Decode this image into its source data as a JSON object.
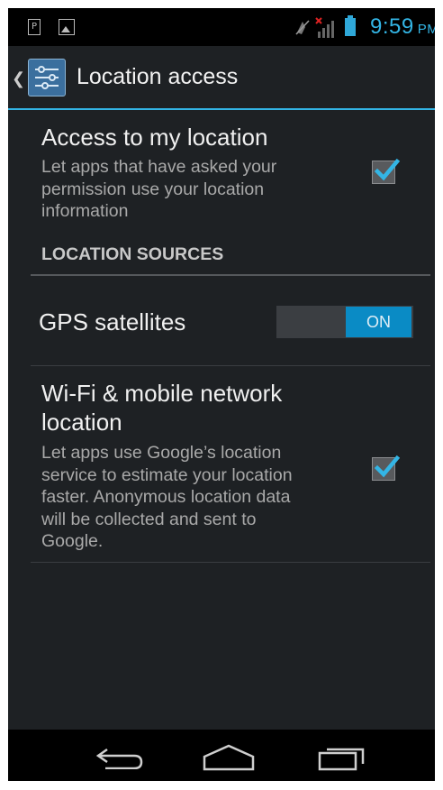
{
  "status_bar": {
    "left_icons": [
      "p-notification-icon",
      "image-notification-icon"
    ],
    "p_label": "P",
    "right_icons": [
      "mute-icon",
      "signal-icon",
      "battery-icon"
    ],
    "time": "9:59",
    "ampm": "PM",
    "accent_color": "#33b5e5"
  },
  "action_bar": {
    "back_icon": "chevron-left-icon",
    "app_icon": "settings-sliders-icon",
    "title": "Location access"
  },
  "settings": {
    "access": {
      "title": "Access to my location",
      "summary_lines": [
        "Let apps that have asked your",
        "permission use your location",
        "information"
      ],
      "checked": true
    },
    "section_header": "LOCATION SOURCES",
    "gps": {
      "title": "GPS satellites",
      "toggle_label": "ON",
      "toggle_state": "on"
    },
    "wifi": {
      "title_lines": [
        "Wi-Fi & mobile network",
        "location"
      ],
      "summary_lines": [
        "Let apps use Google’s location",
        "service to estimate your location",
        "faster. Anonymous location data",
        "will be collected and sent to",
        "Google."
      ],
      "checked": true
    }
  },
  "nav_bar": {
    "buttons": [
      "back-icon",
      "home-icon",
      "recent-apps-icon"
    ]
  }
}
